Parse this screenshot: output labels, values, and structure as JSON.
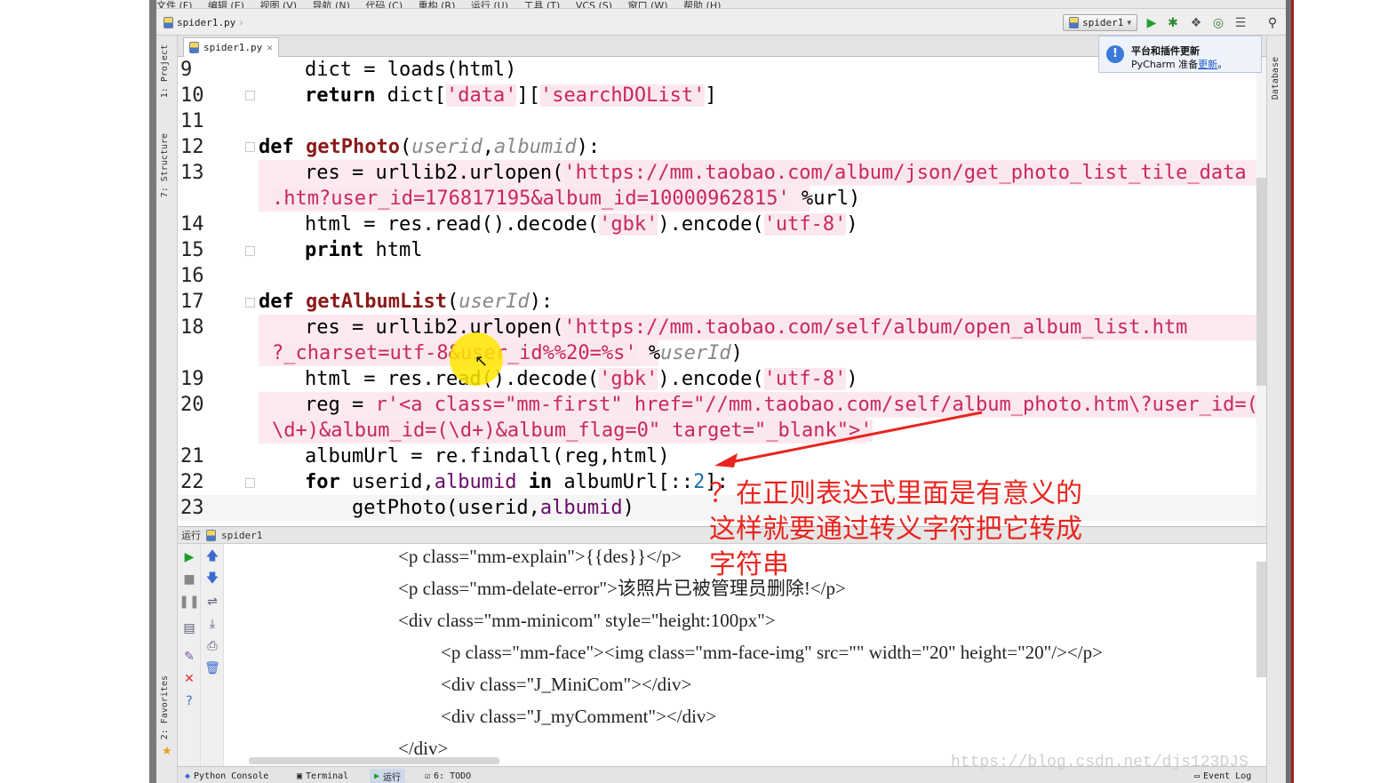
{
  "menu": [
    "文件 (F)",
    "编辑 (E)",
    "视图 (V)",
    "导航 (N)",
    "代码 (C)",
    "重构 (R)",
    "运行 (U)",
    "工具 (T)",
    "VCS (S)",
    "窗口 (W)",
    "帮助 (H)"
  ],
  "toolbar": {
    "breadcrumb": "spider1.py",
    "run_config": "spider1"
  },
  "left_tool_windows": [
    "1: Project",
    "7: Structure",
    "2: Favorites"
  ],
  "right_tool_windows": [
    "Database"
  ],
  "editor": {
    "tab_label": "spider1.py",
    "lines": {
      "n9": "9",
      "n10": "10",
      "n11": "11",
      "n12": "12",
      "n13": "13",
      "n14": "14",
      "n15": "15",
      "n16": "16",
      "n17": "17",
      "n18": "18",
      "n19": "19",
      "n20": "20",
      "n21": "21",
      "n22": "22",
      "n23": "23"
    },
    "code": {
      "l9": "dict = loads(html)",
      "l10_kw": "return",
      "l10_a": " dict[",
      "l10_s1": "'data'",
      "l10_b": "][",
      "l10_s2": "'searchDOList'",
      "l10_c": "]",
      "l12_kw": "def",
      "l12_fn": "getPhoto",
      "l12_a": "(",
      "l12_p1": "userid",
      "l12_b": ",",
      "l12_p2": "albumid",
      "l12_c": "):",
      "l13_a": "res = urllib2.urlopen(",
      "l13_s": "'https://mm.taobao.com/album/json/get_photo_list_tile_data",
      "l13w_s": ".htm?user_id=176817195&album_id=10000962815'",
      "l13w_b": " %url)",
      "l14_a": "html = res.read().decode(",
      "l14_s1": "'gbk'",
      "l14_b": ").encode(",
      "l14_s2": "'utf-8'",
      "l14_c": ")",
      "l15_kw": "print",
      "l15_a": " html",
      "l17_kw": "def",
      "l17_fn": "getAlbumList",
      "l17_a": "(",
      "l17_p": "userId",
      "l17_b": "):",
      "l18_a": "res = urllib2.urlopen(",
      "l18_s": "'https://mm.taobao.com/self/album/open_album_list.htm",
      "l18w_s": "?_charset=utf-8&user_id%%20=%s'",
      "l18w_b": " %",
      "l18w_p": "userId",
      "l18w_c": ")",
      "l19_a": "html = res.read().decode(",
      "l19_s1": "'gbk'",
      "l19_b": ").encode(",
      "l19_s2": "'utf-8'",
      "l19_c": ")",
      "l20_a": "reg = ",
      "l20_s": "r'<a class=\"mm-first\" href=\"//mm.taobao.com/self/album_photo.htm\\?user_id=(",
      "l20w_s": "\\d+)&album_id=(\\d+)&album_flag=0\" target=\"_blank\">'",
      "l21": "albumUrl = re.findall(reg,html)",
      "l22_kw1": "for",
      "l22_a": " userid,",
      "l22_v": "albumid",
      "l22_sp": " ",
      "l22_kw2": "in",
      "l22_b": " albumUrl[::",
      "l22_n": "2",
      "l22_c": "]:",
      "l23_a": "getPhoto(userid,",
      "l23_v": "albumid",
      "l23_c": ")"
    }
  },
  "notification": {
    "title": "平台和插件更新",
    "text": "PyCharm 准备",
    "link": "更新",
    "suffix": "。"
  },
  "run_panel": {
    "header": "运行",
    "config": "spider1",
    "output": [
      "<p class=\"mm-explain\">{{des}}</p>",
      "<p class=\"mm-delate-error\">该照片已被管理员删除!</p>",
      "<div class=\"mm-minicom\" style=\"height:100px\">",
      "<p class=\"mm-face\"><img class=\"mm-face-img\" src=\"\" width=\"20\" height=\"20\"/></p>",
      "<div class=\"J_MiniCom\"></div>",
      "<div class=\"J_myComment\"></div>",
      "</div>"
    ]
  },
  "annotation": {
    "line1": "？在正则表达式里面是有意义的",
    "line2": "这样就要通过转义字符把它转成",
    "line3": "字符串"
  },
  "bottom_tabs": {
    "python_console": "Python Console",
    "terminal": "Terminal",
    "run": "运行",
    "todo": "6: TODO",
    "event_log": "Event Log"
  },
  "watermark": "https://blog.csdn.net/djs123DJS",
  "colors": {
    "keyword": "#000000",
    "function": "#8a1a1a",
    "string": "#c8285a",
    "string_bg": "#fbe7ef",
    "annotation": "#e8251f",
    "cursor_highlight": "#ffe600"
  }
}
